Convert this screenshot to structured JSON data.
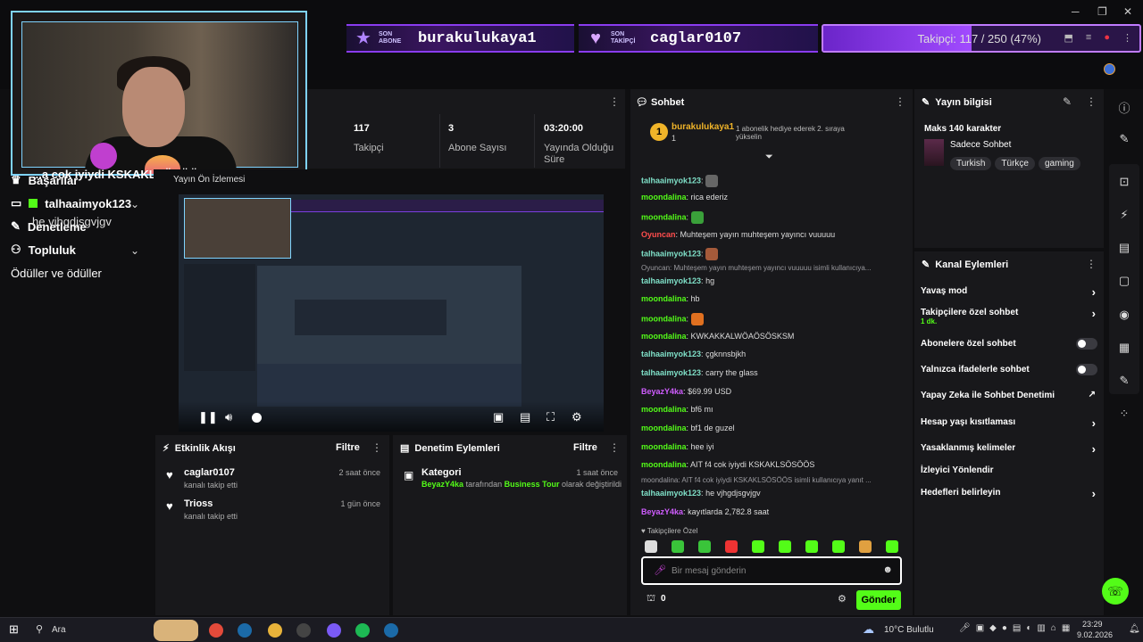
{
  "overlay": {
    "sub_label": "SON ABONE",
    "sub_name": "burakulukaya1",
    "follow_label": "SON TAKİPÇİ",
    "follow_name": "caglar0107",
    "goal_text": "Takipçi: 117 / 250 (47%)",
    "goal_fraction": 0.47,
    "stream_title_fragment": "...a cok iyiydi KSKAKLSÖSÖÖS"
  },
  "sidebar": {
    "items": [
      {
        "label": "Başarılar"
      },
      {
        "label": "talhaaimyok123"
      },
      {
        "label": "Denetleme"
      },
      {
        "label": "he vjhgdjsgvjgv"
      },
      {
        "label": "Topluluk"
      },
      {
        "label": "Ödüller ve ödüller"
      }
    ],
    "preview_label": "Yayın Ön İzlemesi"
  },
  "stats": [
    {
      "value": "117",
      "label": "Takipçi"
    },
    {
      "value": "3",
      "label": "Abone Sayısı"
    },
    {
      "value": "03:20:00",
      "label": "Yayında Olduğu Süre"
    }
  ],
  "activity": {
    "title": "Etkinlik Akışı",
    "filter": "Filtre",
    "events": [
      {
        "name": "caglar0107",
        "sub": "kanalı takip etti",
        "time": "2 saat önce"
      },
      {
        "name": "Trioss",
        "sub": "kanalı takip etti",
        "time": "1 gün önce"
      }
    ]
  },
  "moderation": {
    "title": "Denetim Eylemleri",
    "filter": "Filtre",
    "item_title": "Kategori",
    "item_time": "1 saat önce",
    "item_user": "BeyazY4ka",
    "item_mid": "tarafından",
    "item_cat": "Business Tour",
    "item_end": "olarak değiştirildi"
  },
  "chat": {
    "title": "Sohbet",
    "pinned_user": "burakulukaya1",
    "pinned_count": "1",
    "pinned_text": "1 abonelik hediye ederek 2. sıraya yükselin",
    "messages": [
      {
        "user": "talhaaimyok123",
        "text": "",
        "color": "#7fe0c8"
      },
      {
        "user": "moondalina",
        "text": "rica ederiz",
        "color": "#53fc18"
      },
      {
        "user": "moondalina",
        "text": "",
        "color": "#53fc18"
      },
      {
        "user": "Oyuncan",
        "text": "Muhteşem yayın muhteşem yayıncı vuuuuu",
        "color": "#ff4d4d"
      },
      {
        "user": "talhaaimyok123",
        "text": "",
        "color": "#7fe0c8"
      },
      {
        "user": "talhaaimyok123",
        "text": "hg",
        "color": "#7fe0c8"
      },
      {
        "user": "moondalina",
        "text": "hb",
        "color": "#53fc18"
      },
      {
        "user": "moondalina",
        "text": "",
        "color": "#53fc18"
      },
      {
        "user": "moondalina",
        "text": "KWKAKKALWÖAÖSÖSKSM",
        "color": "#53fc18"
      },
      {
        "user": "talhaaimyok123",
        "text": "çgknnsbjkh",
        "color": "#7fe0c8"
      },
      {
        "user": "talhaaimyok123",
        "text": "carry the glass",
        "color": "#7fe0c8"
      },
      {
        "user": "BeyazY4ka",
        "text": "$69.99 USD",
        "color": "#d05dff"
      },
      {
        "user": "moondalina",
        "text": "bf6 mı",
        "color": "#53fc18"
      },
      {
        "user": "moondalina",
        "text": "bf1 de guzel",
        "color": "#53fc18"
      },
      {
        "user": "moondalina",
        "text": "hee iyi",
        "color": "#53fc18"
      },
      {
        "user": "moondalina",
        "text": "AIT f4 cok iyiydi KSKAKLSÖSÖÖS",
        "color": "#53fc18"
      },
      {
        "user": "talhaaimyok123",
        "text": "he vjhgdjsgvjgv",
        "color": "#7fe0c8"
      },
      {
        "user": "BeyazY4ka",
        "text": "kayıtlarda 2,782.8 saat",
        "color": "#d05dff"
      }
    ],
    "reply_1": "Oyuncan: Muhteşem yayın muhteşem yayıncı vuuuuu isimli kullanıcıya...",
    "reply_2": "moondalina: AIT f4 cok iyiydi KSKAKLSÖSÖÖS isimli kullanıcıya yanıt ...",
    "followers_only": "Takipçilere Özel",
    "placeholder": "Bir mesaj gönderin",
    "points": "0",
    "send": "Gönder"
  },
  "info": {
    "title": "Yayın bilgisi",
    "max_chars": "Maks 140 karakter",
    "category": "Sadece Sohbet",
    "tags": [
      "Turkish",
      "Türkçe",
      "gaming"
    ]
  },
  "actions": {
    "title": "Kanal Eylemleri",
    "rows": [
      {
        "label": "Yavaş mod",
        "kind": "arrow"
      },
      {
        "label": "Takipçilere özel sohbet",
        "sub": "1 dk.",
        "kind": "arrow"
      },
      {
        "label": "Abonelere özel sohbet",
        "kind": "toggle"
      },
      {
        "label": "Yalnızca ifadelerle sohbet",
        "kind": "toggle"
      },
      {
        "label": "Yapay Zeka ile Sohbet Denetimi",
        "kind": "external"
      },
      {
        "label": "Hesap yaşı kısıtlaması",
        "kind": "arrow"
      },
      {
        "label": "Yasaklanmış kelimeler",
        "kind": "arrow"
      },
      {
        "label": "İzleyici Yönlendir",
        "kind": "none"
      },
      {
        "label": "Hedefleri belirleyin",
        "kind": "arrow"
      }
    ]
  },
  "taskbar": {
    "search": "Ara",
    "weather": "10°C  Bulutlu",
    "time": "23:29",
    "date": "9.02.2026"
  }
}
